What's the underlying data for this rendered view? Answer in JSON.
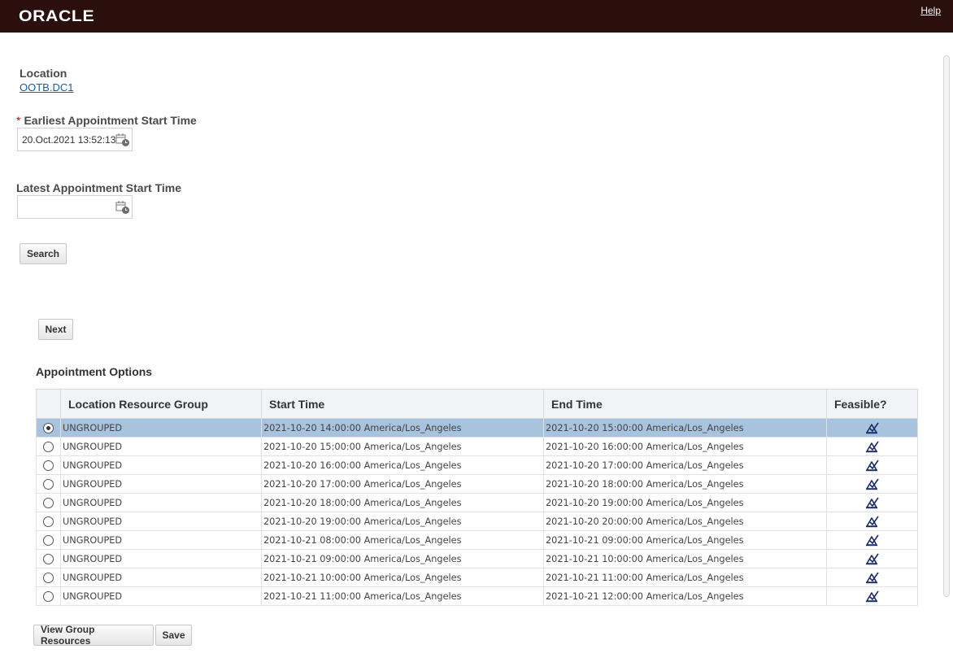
{
  "header": {
    "logo": "ORACLE",
    "help": "Help"
  },
  "form": {
    "location_label": "Location",
    "location_value": "OOTB.DC1",
    "earliest_label": "Earliest Appointment Start Time",
    "earliest_required": "*",
    "earliest_value": "20.Oct.2021 13:52:13",
    "latest_label": "Latest Appointment Start Time",
    "latest_value": "",
    "search_button": "Search",
    "next_button": "Next"
  },
  "options": {
    "title": "Appointment Options",
    "columns": [
      "Location Resource Group",
      "Start Time",
      "End Time",
      "Feasible?"
    ],
    "rows": [
      {
        "group": "UNGROUPED",
        "start": "2021-10-20 14:00:00 America/Los_Angeles",
        "end": "2021-10-20 15:00:00 America/Los_Angeles"
      },
      {
        "group": "UNGROUPED",
        "start": "2021-10-20 15:00:00 America/Los_Angeles",
        "end": "2021-10-20 16:00:00 America/Los_Angeles"
      },
      {
        "group": "UNGROUPED",
        "start": "2021-10-20 16:00:00 America/Los_Angeles",
        "end": "2021-10-20 17:00:00 America/Los_Angeles"
      },
      {
        "group": "UNGROUPED",
        "start": "2021-10-20 17:00:00 America/Los_Angeles",
        "end": "2021-10-20 18:00:00 America/Los_Angeles"
      },
      {
        "group": "UNGROUPED",
        "start": "2021-10-20 18:00:00 America/Los_Angeles",
        "end": "2021-10-20 19:00:00 America/Los_Angeles"
      },
      {
        "group": "UNGROUPED",
        "start": "2021-10-20 19:00:00 America/Los_Angeles",
        "end": "2021-10-20 20:00:00 America/Los_Angeles"
      },
      {
        "group": "UNGROUPED",
        "start": "2021-10-21 08:00:00 America/Los_Angeles",
        "end": "2021-10-21 09:00:00 America/Los_Angeles"
      },
      {
        "group": "UNGROUPED",
        "start": "2021-10-21 09:00:00 America/Los_Angeles",
        "end": "2021-10-21 10:00:00 America/Los_Angeles"
      },
      {
        "group": "UNGROUPED",
        "start": "2021-10-21 10:00:00 America/Los_Angeles",
        "end": "2021-10-21 11:00:00 America/Los_Angeles"
      },
      {
        "group": "UNGROUPED",
        "start": "2021-10-21 11:00:00 America/Los_Angeles",
        "end": "2021-10-21 12:00:00 America/Los_Angeles"
      }
    ],
    "selected_row": 0,
    "feasible_icon": "feasible-check-icon"
  },
  "footer": {
    "view_group_button": "View Group Resources",
    "save_button": "Save"
  },
  "colors": {
    "header_bg": "#2b0f0d",
    "selected_row": "#a7c3de",
    "link": "#1b5c9e"
  }
}
